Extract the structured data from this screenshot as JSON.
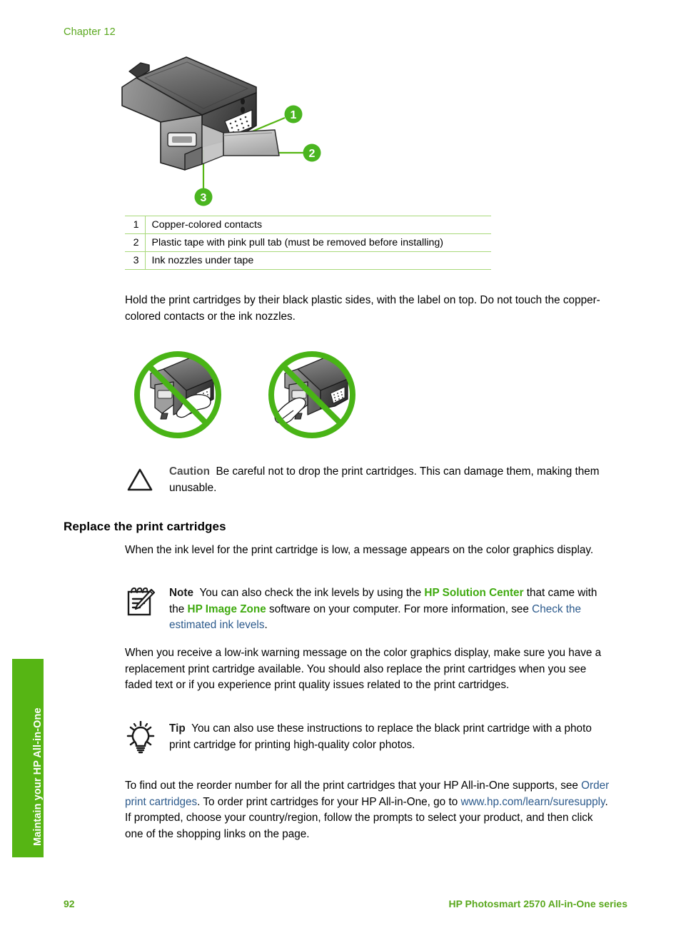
{
  "page": {
    "chapter_label": "Chapter 12",
    "side_tab_label": "Maintain your HP All-in-One",
    "footer": {
      "page_number": "92",
      "product_name": "HP Photosmart 2570 All-in-One series"
    }
  },
  "figure": {
    "name": "print-cartridge-diagram",
    "callouts": [
      "1",
      "2",
      "3"
    ]
  },
  "legend": {
    "rows": [
      {
        "num": "1",
        "desc": "Copper-colored contacts"
      },
      {
        "num": "2",
        "desc": "Plastic tape with pink pull tab (must be removed before installing)"
      },
      {
        "num": "3",
        "desc": "Ink nozzles under tape"
      }
    ]
  },
  "body": {
    "hold_paragraph": "Hold the print cartridges by their black plastic sides, with the label on top. Do not touch the copper-colored contacts or the ink nozzles.",
    "caution": {
      "lead": "Caution",
      "text": "Be careful not to drop the print cartridges. This can damage them, making them unusable."
    },
    "section_heading": "Replace the print cartridges",
    "low_ink_paragraph": "When the ink level for the print cartridge is low, a message appears on the color graphics display.",
    "note": {
      "lead": "Note",
      "text_1": "You can also check the ink levels by using the",
      "link_solution_center": "HP Solution Center",
      "text_2": "that came with the",
      "link_image_zone": "HP Image Zone",
      "text_3": "software on your computer. For more information, see",
      "xref_ink_levels": "Check the estimated ink levels",
      "text_4": "."
    },
    "warning_paragraph": "When you receive a low-ink warning message on the color graphics display, make sure you have a replacement print cartridge available. You should also replace the print cartridges when you see faded text or if you experience print quality issues related to the print cartridges.",
    "tip": {
      "lead": "Tip",
      "text": "You can also use these instructions to replace the black print cartridge with a photo print cartridge for printing high-quality color photos."
    },
    "reorder": {
      "text_1": "To find out the reorder number for all the print cartridges that your HP All-in-One supports, see",
      "xref_order": "Order print cartridges",
      "text_2": ". To order print cartridges for your HP All-in-One, go to",
      "link_url": "www.hp.com/learn/suresupply",
      "text_3": ". If prompted, choose your country/region, follow the prompts to select your product, and then click one of the shopping links on the page."
    }
  },
  "colors": {
    "hp_green": "#56b514",
    "header_green": "#5aa81e",
    "link_blue": "#2c5a8c",
    "inline_green": "#3faa0f",
    "rule_green": "#a8d97a"
  }
}
